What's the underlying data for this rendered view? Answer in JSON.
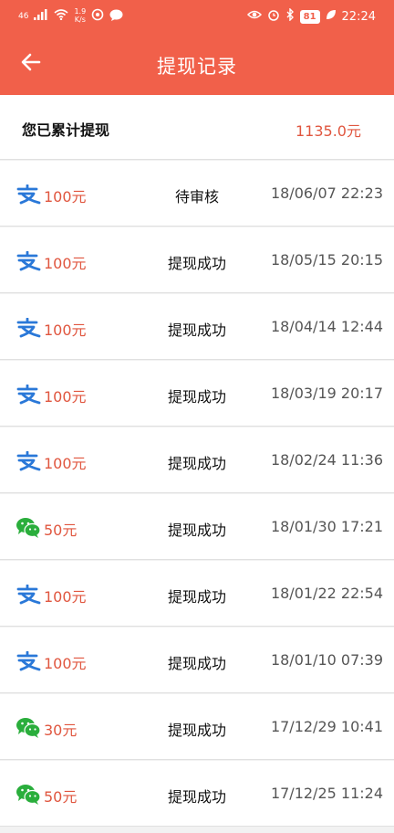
{
  "status_bar": {
    "signal": "46",
    "net_speed_value": "1.9",
    "net_speed_unit": "K/s",
    "battery": "81",
    "time": "22:24"
  },
  "header": {
    "title": "提现记录",
    "back_icon": "arrow-left-icon"
  },
  "summary": {
    "label": "您已累计提现",
    "value": "1135.0元"
  },
  "colors": {
    "brand": "#f1604a",
    "amount": "#e0563f",
    "alipay": "#2a78d8",
    "wechat": "#2aae3c"
  },
  "records": [
    {
      "method": "alipay",
      "amount": "100元",
      "status": "待审核",
      "time": "18/06/07 22:23"
    },
    {
      "method": "alipay",
      "amount": "100元",
      "status": "提现成功",
      "time": "18/05/15 20:15"
    },
    {
      "method": "alipay",
      "amount": "100元",
      "status": "提现成功",
      "time": "18/04/14 12:44"
    },
    {
      "method": "alipay",
      "amount": "100元",
      "status": "提现成功",
      "time": "18/03/19 20:17"
    },
    {
      "method": "alipay",
      "amount": "100元",
      "status": "提现成功",
      "time": "18/02/24 11:36"
    },
    {
      "method": "wechat",
      "amount": "50元",
      "status": "提现成功",
      "time": "18/01/30 17:21"
    },
    {
      "method": "alipay",
      "amount": "100元",
      "status": "提现成功",
      "time": "18/01/22 22:54"
    },
    {
      "method": "alipay",
      "amount": "100元",
      "status": "提现成功",
      "time": "18/01/10 07:39"
    },
    {
      "method": "wechat",
      "amount": "30元",
      "status": "提现成功",
      "time": "17/12/29 10:41"
    },
    {
      "method": "wechat",
      "amount": "50元",
      "status": "提现成功",
      "time": "17/12/25 11:24"
    }
  ]
}
